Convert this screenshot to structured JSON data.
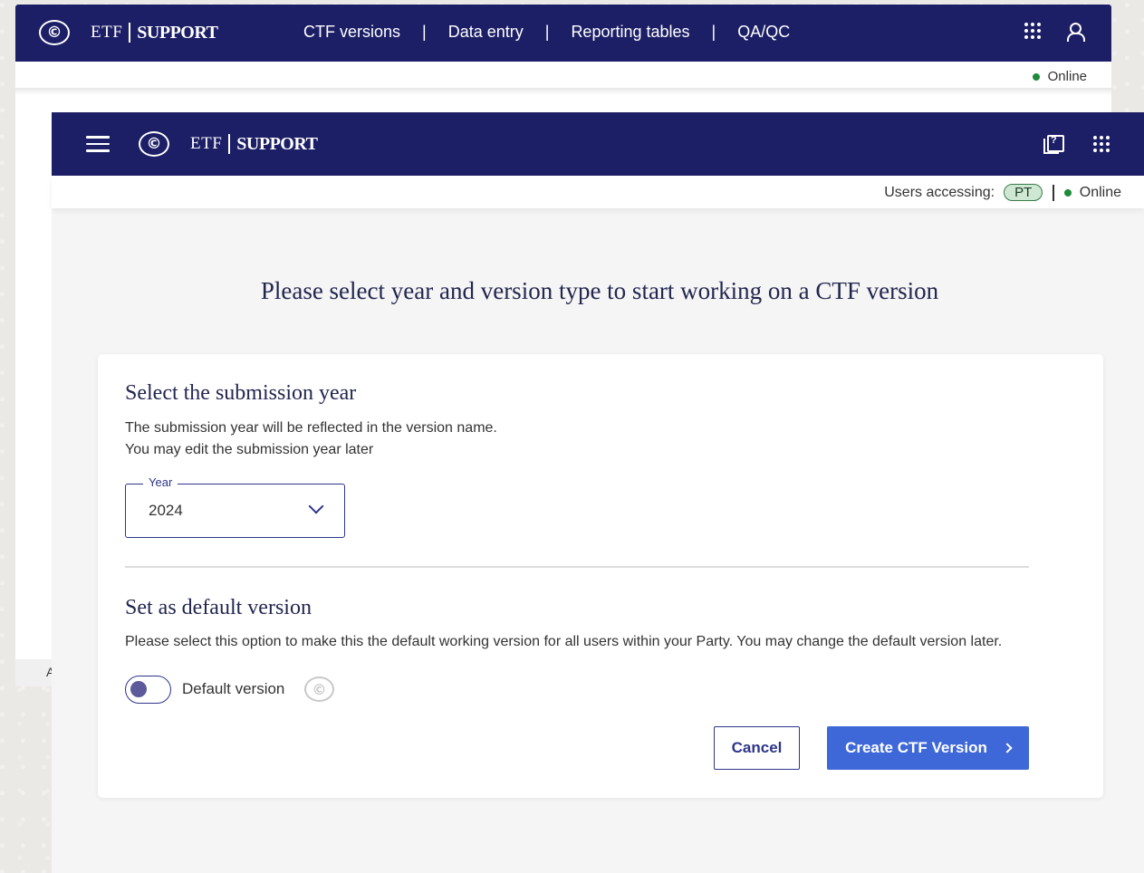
{
  "brand": {
    "etf": "ETF",
    "support": "SUPPORT",
    "emblem": "©"
  },
  "back_window": {
    "nav": [
      "CTF versions",
      "Data entry",
      "Reporting tables",
      "QA/QC"
    ],
    "nav_separator": "|",
    "status": "Online",
    "footer_fragment": "A"
  },
  "front_window": {
    "users_accessing_label": "Users accessing:",
    "user_badge": "PT",
    "status": "Online",
    "prompt": "Please select year and version type to start working on a CTF version"
  },
  "card": {
    "year_section": {
      "title": "Select the submission year",
      "line1": "The submission year will be reflected in the version name.",
      "line2": "You may edit the submission year later",
      "field_label": "Year",
      "selected_value": "2024"
    },
    "default_section": {
      "title": "Set as default version",
      "description": "Please select this option to make this the default working version for all users within your Party. You may change the default version later.",
      "toggle_label": "Default version"
    },
    "buttons": {
      "cancel": "Cancel",
      "create": "Create CTF Version"
    }
  },
  "colors": {
    "header_navy": "#1c1f66",
    "primary_blue": "#3e68d8",
    "online_green": "#1d8a3c",
    "badge_green": "#cfe8d3"
  },
  "icons": [
    "un-emblem-icon",
    "apps-grid-icon",
    "user-icon",
    "hamburger-menu-icon",
    "help-icon",
    "chevron-down-icon",
    "chevron-right-icon"
  ]
}
